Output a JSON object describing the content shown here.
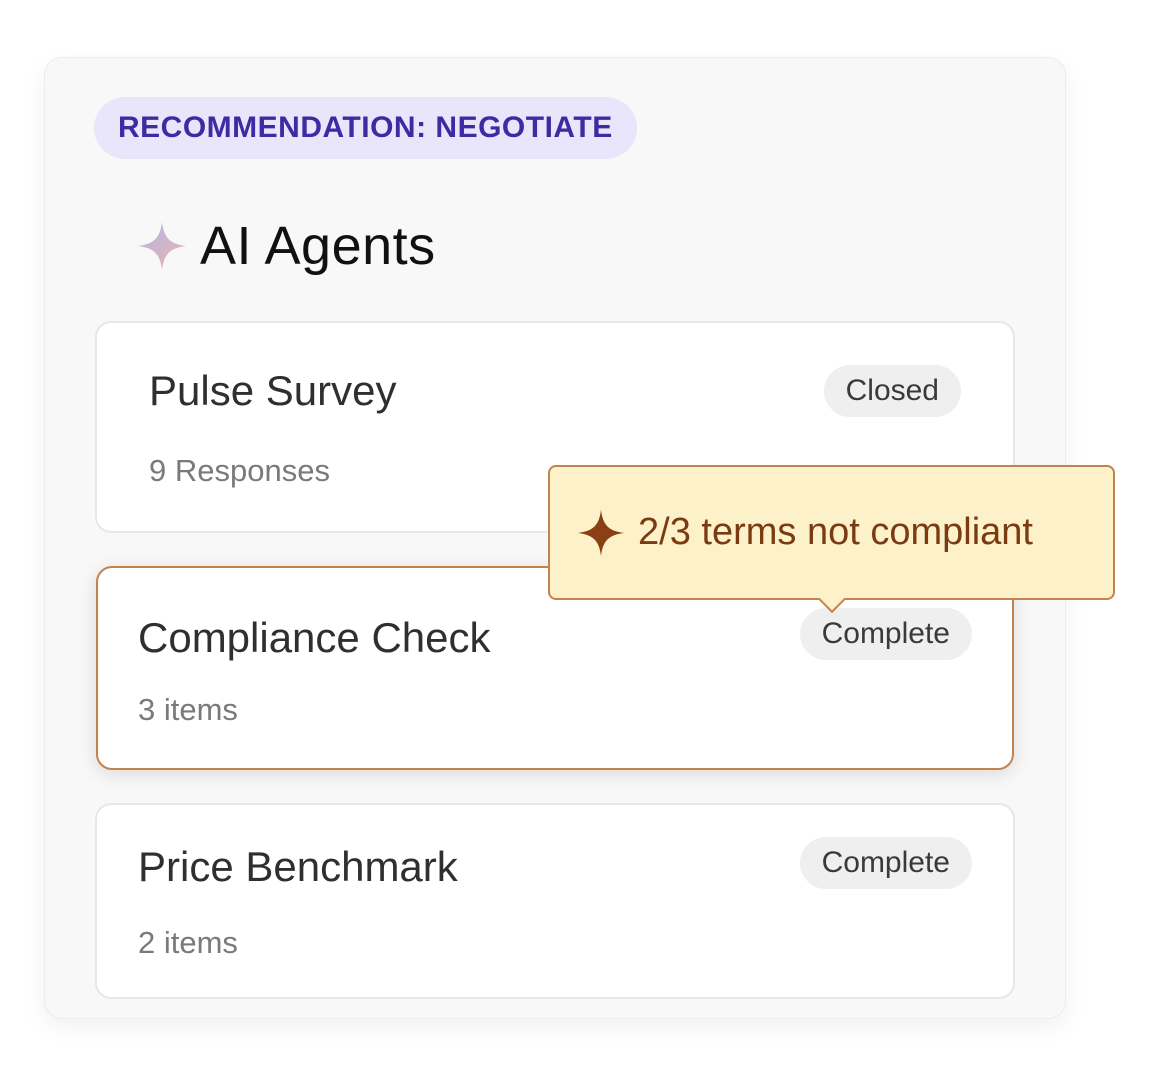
{
  "recommendation": {
    "label": "RECOMMENDATION: NEGOTIATE"
  },
  "section": {
    "icon": "sparkle-icon",
    "title": "AI Agents"
  },
  "agents": [
    {
      "title": "Pulse Survey",
      "subtitle": "9 Responses",
      "status": "Closed"
    },
    {
      "title": "Compliance Check",
      "subtitle": "3 items",
      "status": "Complete",
      "highlighted": true
    },
    {
      "title": "Price Benchmark",
      "subtitle": "2 items",
      "status": "Complete"
    }
  ],
  "tooltip": {
    "icon": "sparkle-icon",
    "text": "2/3 terms not compliant"
  },
  "colors": {
    "accent_purple": "#3f2aa3",
    "pill_bg": "#e9e5fb",
    "highlight_border": "#c3834e",
    "tooltip_bg": "#fdf1c9",
    "tooltip_text": "#7a3a12"
  }
}
